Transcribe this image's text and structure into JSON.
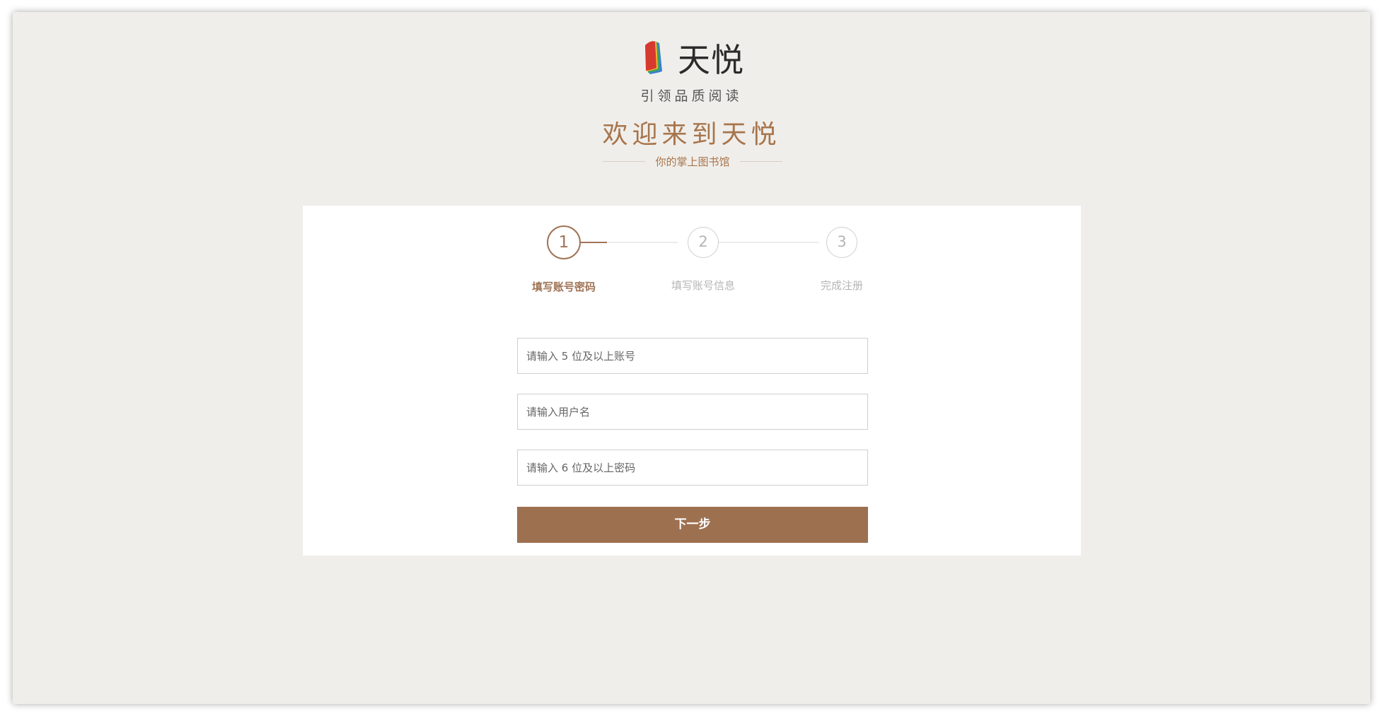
{
  "brand": {
    "name": "天悦",
    "slogan": "引领品质阅读",
    "logo_colors": [
      "#d63a2f",
      "#f2b632",
      "#3aa55a",
      "#3b7fd6"
    ]
  },
  "header": {
    "welcome": "欢迎来到天悦",
    "subtitle": "你的掌上图书馆"
  },
  "steps": [
    {
      "number": "1",
      "label": "填写账号密码",
      "active": true
    },
    {
      "number": "2",
      "label": "填写账号信息",
      "active": false
    },
    {
      "number": "3",
      "label": "完成注册",
      "active": false
    }
  ],
  "form": {
    "account_placeholder": "请输入 5 位及以上账号",
    "username_placeholder": "请输入用户名",
    "password_placeholder": "请输入 6 位及以上密码",
    "next_label": "下一步"
  },
  "colors": {
    "accent": "#a07456",
    "button": "#9d7050",
    "background": "#f0eeea"
  }
}
